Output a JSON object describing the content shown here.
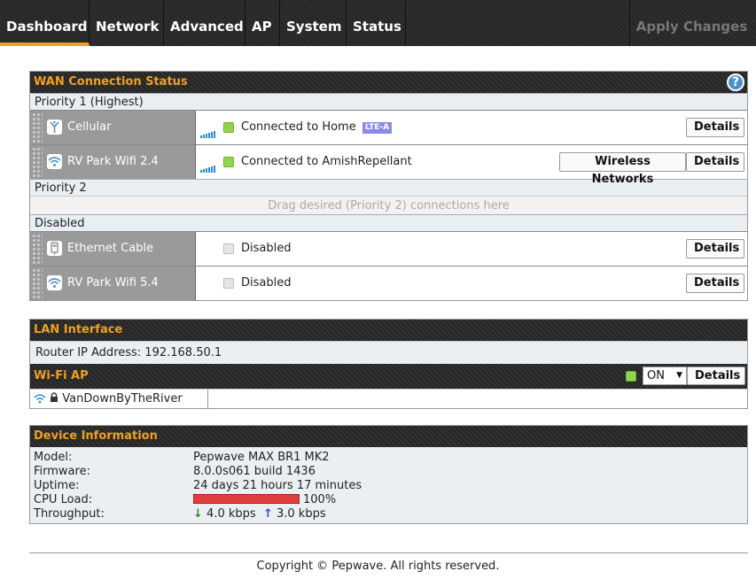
{
  "nav": {
    "tabs": [
      "Dashboard",
      "Network",
      "Advanced",
      "AP",
      "System",
      "Status"
    ],
    "active": "Dashboard",
    "apply_label": "Apply Changes"
  },
  "wan": {
    "title": "WAN Connection Status",
    "help_icon": "help-icon",
    "priority1_label": "Priority 1 (Highest)",
    "priority2_label": "Priority 2",
    "priority2_drop": "Drag desired (Priority 2) connections here",
    "disabled_label": "Disabled",
    "connections": [
      {
        "name": "Cellular",
        "icon": "cellular-icon",
        "status": "Connected to Home",
        "badge": "LTE-A",
        "details_label": "Details"
      },
      {
        "name": "RV Park Wifi 2.4",
        "icon": "wifi-icon",
        "status": "Connected to AmishRepellant",
        "extra_button": "Wireless Networks",
        "details_label": "Details"
      },
      {
        "name": "Ethernet Cable",
        "icon": "ethernet-icon",
        "status": "Disabled",
        "details_label": "Details"
      },
      {
        "name": "RV Park Wifi 5.4",
        "icon": "wifi-icon",
        "status": "Disabled",
        "details_label": "Details"
      }
    ],
    "colors": {
      "connected": "#8fd64a",
      "signal": "#2a8ad8"
    }
  },
  "lan": {
    "title": "LAN Interface",
    "router_ip_text": "Router IP Address: 192.168.50.1"
  },
  "wifi_ap": {
    "title": "Wi-Fi AP",
    "toggle_value": "ON",
    "details_label": "Details",
    "ssid": "VanDownByTheRiver"
  },
  "device": {
    "title": "Device Information",
    "model_label": "Model:",
    "model": "Pepwave MAX BR1 MK2",
    "firmware_label": "Firmware:",
    "firmware": "8.0.0s061 build 1436",
    "uptime_label": "Uptime:",
    "uptime": "24 days 21 hours 17 minutes",
    "cpu_label": "CPU Load:",
    "cpu": "100%",
    "cpu_fraction": 1.0,
    "throughput_label": "Throughput:",
    "down": "4.0 kbps",
    "up": "3.0 kbps",
    "colors": {
      "cpu_bar": "#e03e3e",
      "accent": "#f0a020"
    }
  },
  "footer": "Copyright © Pepwave. All rights reserved."
}
